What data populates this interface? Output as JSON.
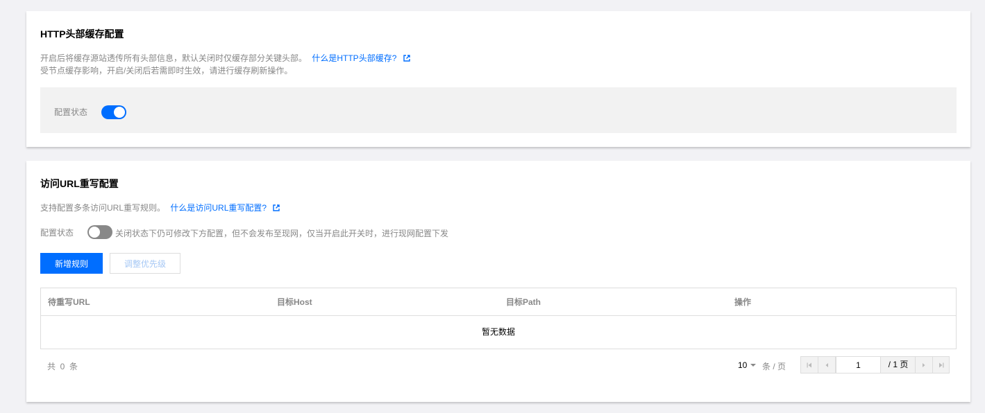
{
  "http_header_cache": {
    "title": "HTTP头部缓存配置",
    "desc_line1": "开启后将缓存源站透传所有头部信息，默认关闭时仅缓存部分关键头部。",
    "help_link": "什么是HTTP头部缓存?",
    "desc_line2": "受节点缓存影响，开启/关闭后若需即时生效，请进行缓存刷新操作。",
    "status_label": "配置状态",
    "status_on": true
  },
  "url_rewrite": {
    "title": "访问URL重写配置",
    "desc": "支持配置多条访问URL重写规则。",
    "help_link": "什么是访问URL重写配置?",
    "status_label": "配置状态",
    "status_on": false,
    "status_hint": "关闭状态下仍可修改下方配置，但不会发布至现网，仅当开启此开关时，进行现网配置下发",
    "add_button": "新增规则",
    "priority_button": "调整优先级",
    "table": {
      "columns": [
        "待重写URL",
        "目标Host",
        "目标Path",
        "操作"
      ],
      "empty_text": "暂无数据"
    },
    "pagination": {
      "total_text": "共  0  条",
      "page_size": "10",
      "per_page_text": "条 / 页",
      "current_page": "1",
      "of_pages_text": "/ 1 页"
    }
  },
  "icons": {
    "external_link": "external-link-icon",
    "first_page": "first-page-icon",
    "prev_page": "prev-page-icon",
    "next_page": "next-page-icon",
    "last_page": "last-page-icon"
  },
  "colors": {
    "accent": "#006eff",
    "switch_off": "#888888",
    "panel_bg": "#f2f2f2"
  }
}
